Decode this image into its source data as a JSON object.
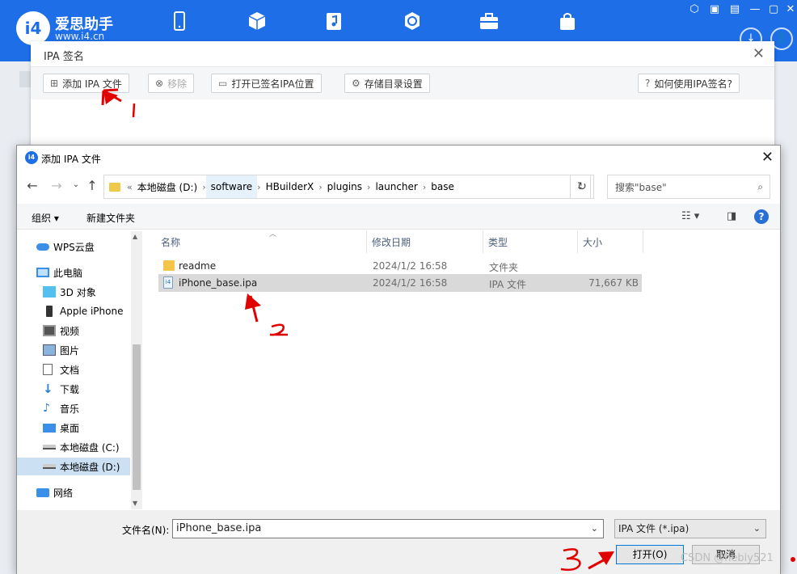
{
  "app": {
    "brand": "爱思助手",
    "url": "www.i4.cn",
    "logo_text": "i4"
  },
  "ipa_panel": {
    "title": "IPA 签名",
    "buttons": {
      "add": "添加 IPA 文件",
      "remove": "移除",
      "open_signed": "打开已签名IPA位置",
      "storage": "存储目录设置",
      "help": "如何使用IPA签名?"
    }
  },
  "dialog": {
    "title": "添加 IPA 文件",
    "breadcrumb_prefix": "«",
    "breadcrumbs": [
      "本地磁盘 (D:)",
      "software",
      "HBuilderX",
      "plugins",
      "launcher",
      "base"
    ],
    "search_placeholder": "搜索\"base\"",
    "commands": {
      "organize": "组织 ▾",
      "new_folder": "新建文件夹"
    },
    "nav_items": [
      {
        "label": "WPS云盘",
        "icon": "cloud-icon"
      },
      {
        "label": "此电脑",
        "icon": "computer-icon"
      },
      {
        "label": "3D 对象",
        "icon": "cube-icon"
      },
      {
        "label": "Apple iPhone",
        "icon": "phone-icon"
      },
      {
        "label": "视频",
        "icon": "video-icon"
      },
      {
        "label": "图片",
        "icon": "picture-icon"
      },
      {
        "label": "文档",
        "icon": "document-icon"
      },
      {
        "label": "下载",
        "icon": "download-icon"
      },
      {
        "label": "音乐",
        "icon": "music-icon"
      },
      {
        "label": "桌面",
        "icon": "desktop-icon"
      },
      {
        "label": "本地磁盘 (C:)",
        "icon": "drive-icon"
      },
      {
        "label": "本地磁盘 (D:)",
        "icon": "drive-icon"
      },
      {
        "label": "网络",
        "icon": "network-icon"
      }
    ],
    "columns": [
      "名称",
      "修改日期",
      "类型",
      "大小"
    ],
    "files": [
      {
        "name": "readme",
        "date": "2024/1/2 16:58",
        "type": "文件夹",
        "size": ""
      },
      {
        "name": "iPhone_base.ipa",
        "date": "2024/1/2 16:58",
        "type": "IPA 文件",
        "size": "71,667 KB"
      }
    ],
    "filename_label": "文件名(N):",
    "filename_value": "iPhone_base.ipa",
    "filetype_value": "IPA 文件 (*.ipa)",
    "open_label": "打开(O)",
    "cancel_label": "取消"
  },
  "watermark": "CSDN @hebiy521",
  "annotations": [
    "1",
    "2",
    "3"
  ],
  "colors": {
    "brand_blue": "#1e6ee8",
    "annotation_red": "#e00000",
    "selection": "#cce0f4"
  }
}
